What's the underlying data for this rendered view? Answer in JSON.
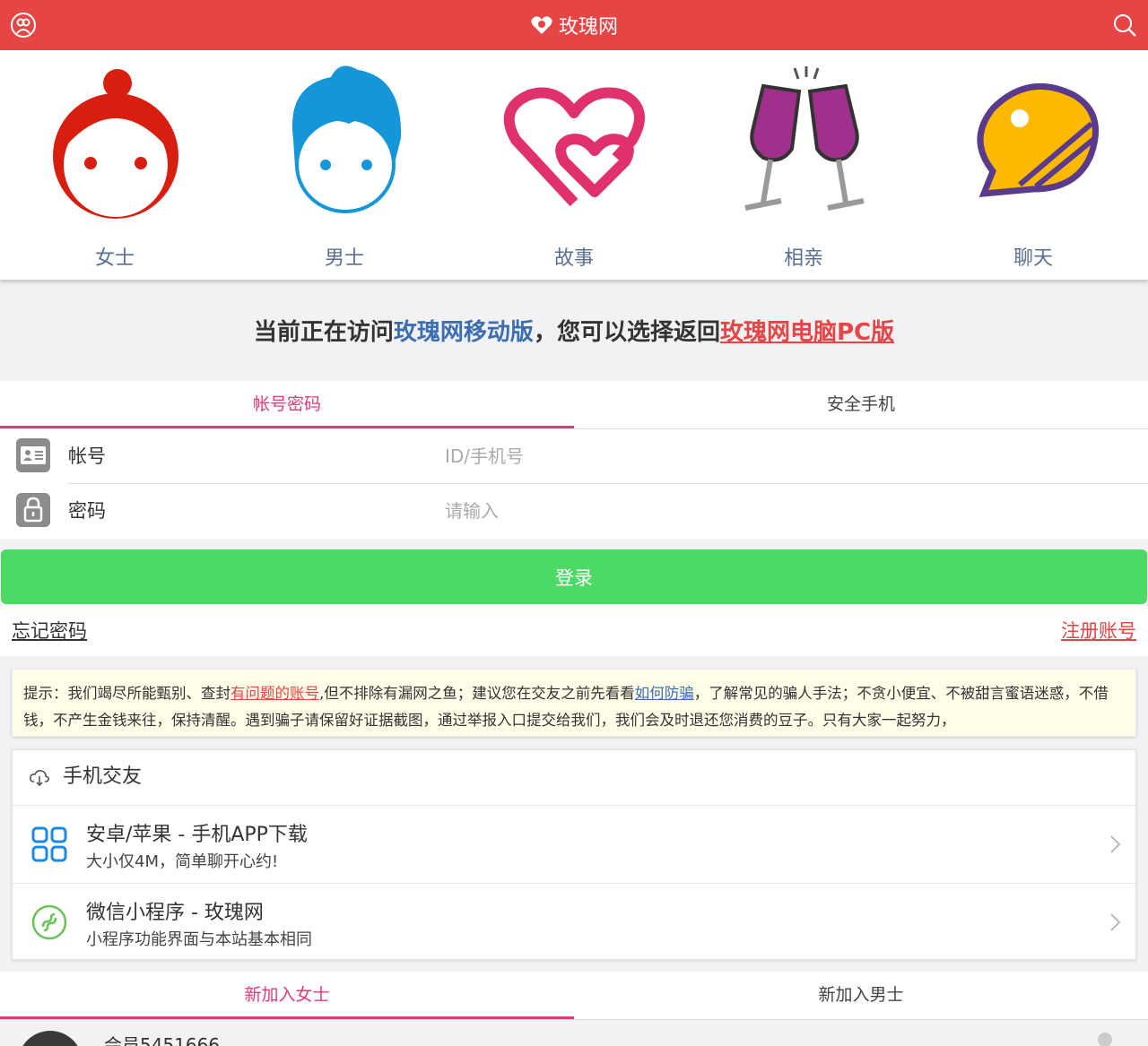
{
  "header": {
    "brand": "玫瑰网"
  },
  "nav": [
    {
      "label": "女士",
      "icon": "woman-icon"
    },
    {
      "label": "男士",
      "icon": "man-icon"
    },
    {
      "label": "故事",
      "icon": "hearts-icon"
    },
    {
      "label": "相亲",
      "icon": "wine-glasses-icon"
    },
    {
      "label": "聊天",
      "icon": "chat-bubble-icon"
    }
  ],
  "notice": {
    "prefix": "当前正在访问",
    "mobile": "玫瑰网移动版",
    "middle": "，您可以选择返回",
    "pc_link": "玫瑰网电脑PC版"
  },
  "login_tabs": [
    "帐号密码",
    "安全手机"
  ],
  "form": {
    "account_label": "帐号",
    "account_placeholder": "ID/手机号",
    "password_label": "密码",
    "password_placeholder": "请输入"
  },
  "login_button": "登录",
  "forgot": "忘记密码",
  "register": "注册账号",
  "tip": {
    "t1": "提示：我们竭尽所能甄别、查封",
    "link1": "有问题的账号",
    "t2": ",但不排除有漏网之鱼；建议您在交友之前先看看",
    "link2": "如何防骗",
    "t3": "，了解常见的骗人手法；不贪小便宜、不被甜言蜜语迷惑，不借钱，不产生金钱来往，保持清醒。遇到骗子请保留好证据截图，通过举报入口提交给我们，我们会及时退还您消费的豆子。只有大家一起努力，"
  },
  "mobile_card": {
    "title": "手机交友",
    "items": [
      {
        "title": "安卓/苹果 - 手机APP下载",
        "subtitle": "大小仅4M，简单聊开心约!"
      },
      {
        "title": "微信小程序 - 玫瑰网",
        "subtitle": "小程序功能界面与本站基本相同"
      }
    ]
  },
  "new_tabs": [
    "新加入女士",
    "新加入男士"
  ],
  "member": {
    "name": "会员5451666"
  },
  "colors": {
    "header": "#e54545",
    "accent": "#e33a7a",
    "login": "#4cd964",
    "link_blue": "#3b6fb0"
  }
}
